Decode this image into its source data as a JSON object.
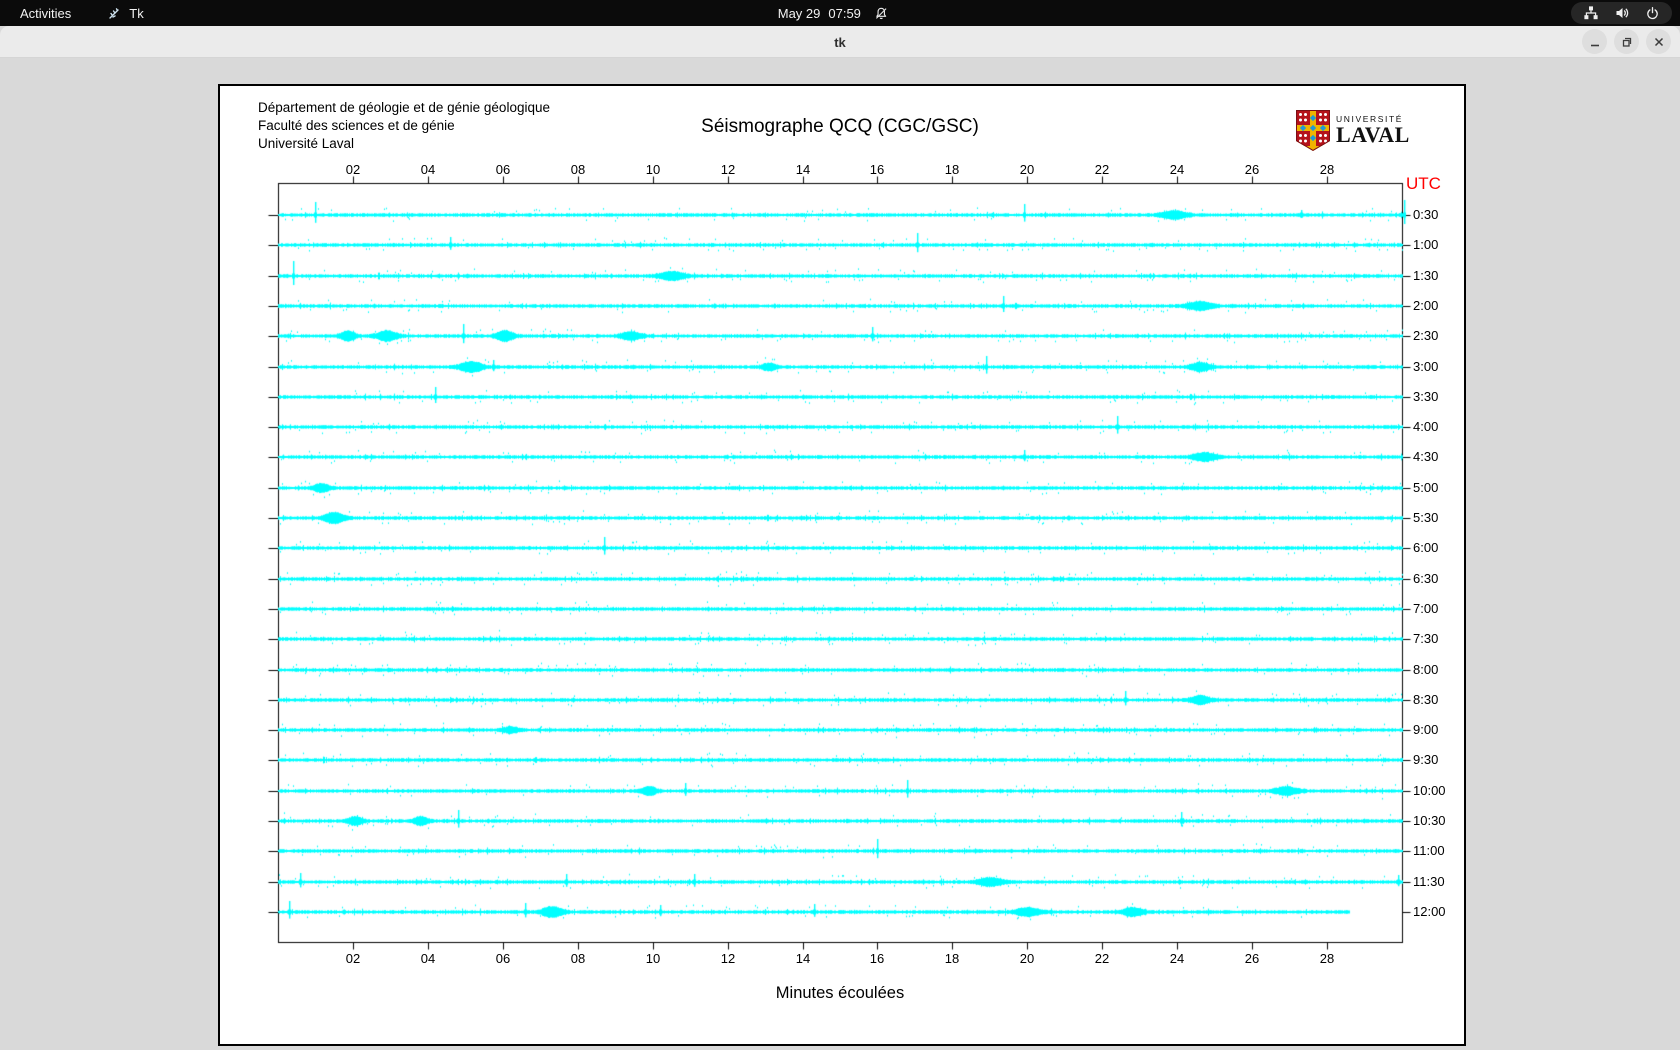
{
  "topbar": {
    "activities_label": "Activities",
    "app_name": "Tk",
    "clock_date": "May 29",
    "clock_time": "07:59"
  },
  "titlebar": {
    "title": "tk"
  },
  "plot": {
    "header_lines": [
      "Département de géologie et de génie géologique",
      "Faculté des sciences et de génie",
      "Université Laval"
    ],
    "title": "Séismographe QCQ (CGC/GSC)",
    "utc_label": "UTC",
    "xlabel": "Minutes écoulées",
    "logo": {
      "top": "UNIVERSITÉ",
      "bottom": "LAVAL"
    }
  },
  "colors": {
    "topbar_bg": "#0b0b0b",
    "titlebar_bg": "#ebebeb",
    "window_bg": "#d9d9d9",
    "canvas_bg": "#ffffff",
    "trace": "#00ffff",
    "utc": "#ff0000"
  },
  "chart_data": {
    "type": "line",
    "title": "Séismographe QCQ (CGC/GSC)",
    "xlabel": "Minutes écoulées",
    "x_range": [
      0,
      30
    ],
    "grid": false,
    "trace_color": "#00ffff",
    "utc_color": "#ff0000",
    "x_ticks": [
      {
        "m": 2,
        "label": "02"
      },
      {
        "m": 4,
        "label": "04"
      },
      {
        "m": 6,
        "label": "06"
      },
      {
        "m": 8,
        "label": "08"
      },
      {
        "m": 10,
        "label": "10"
      },
      {
        "m": 12,
        "label": "12"
      },
      {
        "m": 14,
        "label": "14"
      },
      {
        "m": 16,
        "label": "16"
      },
      {
        "m": 18,
        "label": "18"
      },
      {
        "m": 20,
        "label": "20"
      },
      {
        "m": 22,
        "label": "22"
      },
      {
        "m": 24,
        "label": "24"
      },
      {
        "m": 26,
        "label": "26"
      },
      {
        "m": 28,
        "label": "28"
      }
    ],
    "rows": [
      {
        "label": "0:30",
        "events": [
          [
            "spike",
            1.0,
            13
          ],
          [
            "spike",
            19.9,
            11
          ],
          [
            "blob",
            23.9,
            3.5,
            0.5
          ],
          [
            "spike",
            27.3,
            5
          ],
          [
            "spike",
            30.05,
            15
          ]
        ]
      },
      {
        "label": "1:00",
        "events": [
          [
            "spike",
            4.6,
            8
          ],
          [
            "spike",
            17.05,
            12
          ]
        ]
      },
      {
        "label": "1:30",
        "events": [
          [
            "spike",
            0.4,
            15
          ],
          [
            "blob",
            10.5,
            3.5,
            0.5
          ]
        ]
      },
      {
        "label": "2:00",
        "events": [
          [
            "spike",
            19.35,
            10
          ],
          [
            "blob",
            24.6,
            3.5,
            0.5
          ]
        ]
      },
      {
        "label": "2:30",
        "events": [
          [
            "blob",
            1.85,
            4,
            0.3
          ],
          [
            "blob",
            2.9,
            4.5,
            0.4
          ],
          [
            "spike",
            4.95,
            12
          ],
          [
            "blob",
            6.05,
            4.5,
            0.35
          ],
          [
            "blob",
            9.4,
            3.5,
            0.4
          ],
          [
            "spike",
            15.85,
            9
          ]
        ]
      },
      {
        "label": "3:00",
        "events": [
          [
            "blob",
            5.15,
            4.5,
            0.45
          ],
          [
            "spike",
            5.75,
            7
          ],
          [
            "blob",
            13.1,
            3,
            0.3
          ],
          [
            "spike",
            18.9,
            11
          ],
          [
            "blob",
            24.6,
            3.5,
            0.4
          ]
        ]
      },
      {
        "label": "3:30",
        "events": [
          [
            "spike",
            4.2,
            10
          ]
        ]
      },
      {
        "label": "4:00",
        "events": [
          [
            "spike",
            22.4,
            11
          ]
        ]
      },
      {
        "label": "4:30",
        "events": [
          [
            "spike",
            19.9,
            7
          ],
          [
            "blob",
            24.7,
            3.5,
            0.45
          ]
        ]
      },
      {
        "label": "5:00",
        "events": [
          [
            "blob",
            1.15,
            3.5,
            0.3
          ]
        ]
      },
      {
        "label": "5:30",
        "events": [
          [
            "blob",
            1.5,
            4.5,
            0.4
          ]
        ]
      },
      {
        "label": "6:00",
        "events": [
          [
            "spike",
            8.7,
            11
          ]
        ]
      },
      {
        "label": "6:30",
        "events": []
      },
      {
        "label": "7:00",
        "events": []
      },
      {
        "label": "7:30",
        "events": []
      },
      {
        "label": "8:00",
        "events": []
      },
      {
        "label": "8:30",
        "events": [
          [
            "spike",
            22.6,
            9
          ],
          [
            "blob",
            24.6,
            3.5,
            0.4
          ]
        ]
      },
      {
        "label": "9:00",
        "events": [
          [
            "blob",
            6.2,
            2.5,
            0.3
          ]
        ]
      },
      {
        "label": "9:30",
        "events": []
      },
      {
        "label": "10:00",
        "events": [
          [
            "blob",
            9.9,
            3.5,
            0.3
          ],
          [
            "spike",
            10.85,
            8
          ],
          [
            "spike",
            16.8,
            11
          ],
          [
            "blob",
            26.9,
            3.5,
            0.45
          ]
        ]
      },
      {
        "label": "10:30",
        "events": [
          [
            "blob",
            2.05,
            3.5,
            0.3
          ],
          [
            "blob",
            3.8,
            3.5,
            0.3
          ],
          [
            "spike",
            4.8,
            11
          ],
          [
            "spike",
            24.1,
            9
          ]
        ]
      },
      {
        "label": "11:00",
        "events": [
          [
            "spike",
            16.0,
            12
          ]
        ]
      },
      {
        "label": "11:30",
        "events": [
          [
            "spike",
            0.6,
            9
          ],
          [
            "spike",
            7.7,
            8
          ],
          [
            "spike",
            11.1,
            8
          ],
          [
            "blob",
            19.0,
            3.5,
            0.5
          ],
          [
            "spike",
            29.9,
            7
          ]
        ]
      },
      {
        "label": "12:00",
        "end_minute": 28.6,
        "events": [
          [
            "spike",
            0.3,
            11
          ],
          [
            "spike",
            6.6,
            9
          ],
          [
            "blob",
            7.3,
            4.5,
            0.4
          ],
          [
            "spike",
            10.2,
            7
          ],
          [
            "spike",
            14.3,
            8
          ],
          [
            "blob",
            20.0,
            3.5,
            0.5
          ],
          [
            "blob",
            22.8,
            3.5,
            0.4
          ]
        ]
      }
    ]
  }
}
